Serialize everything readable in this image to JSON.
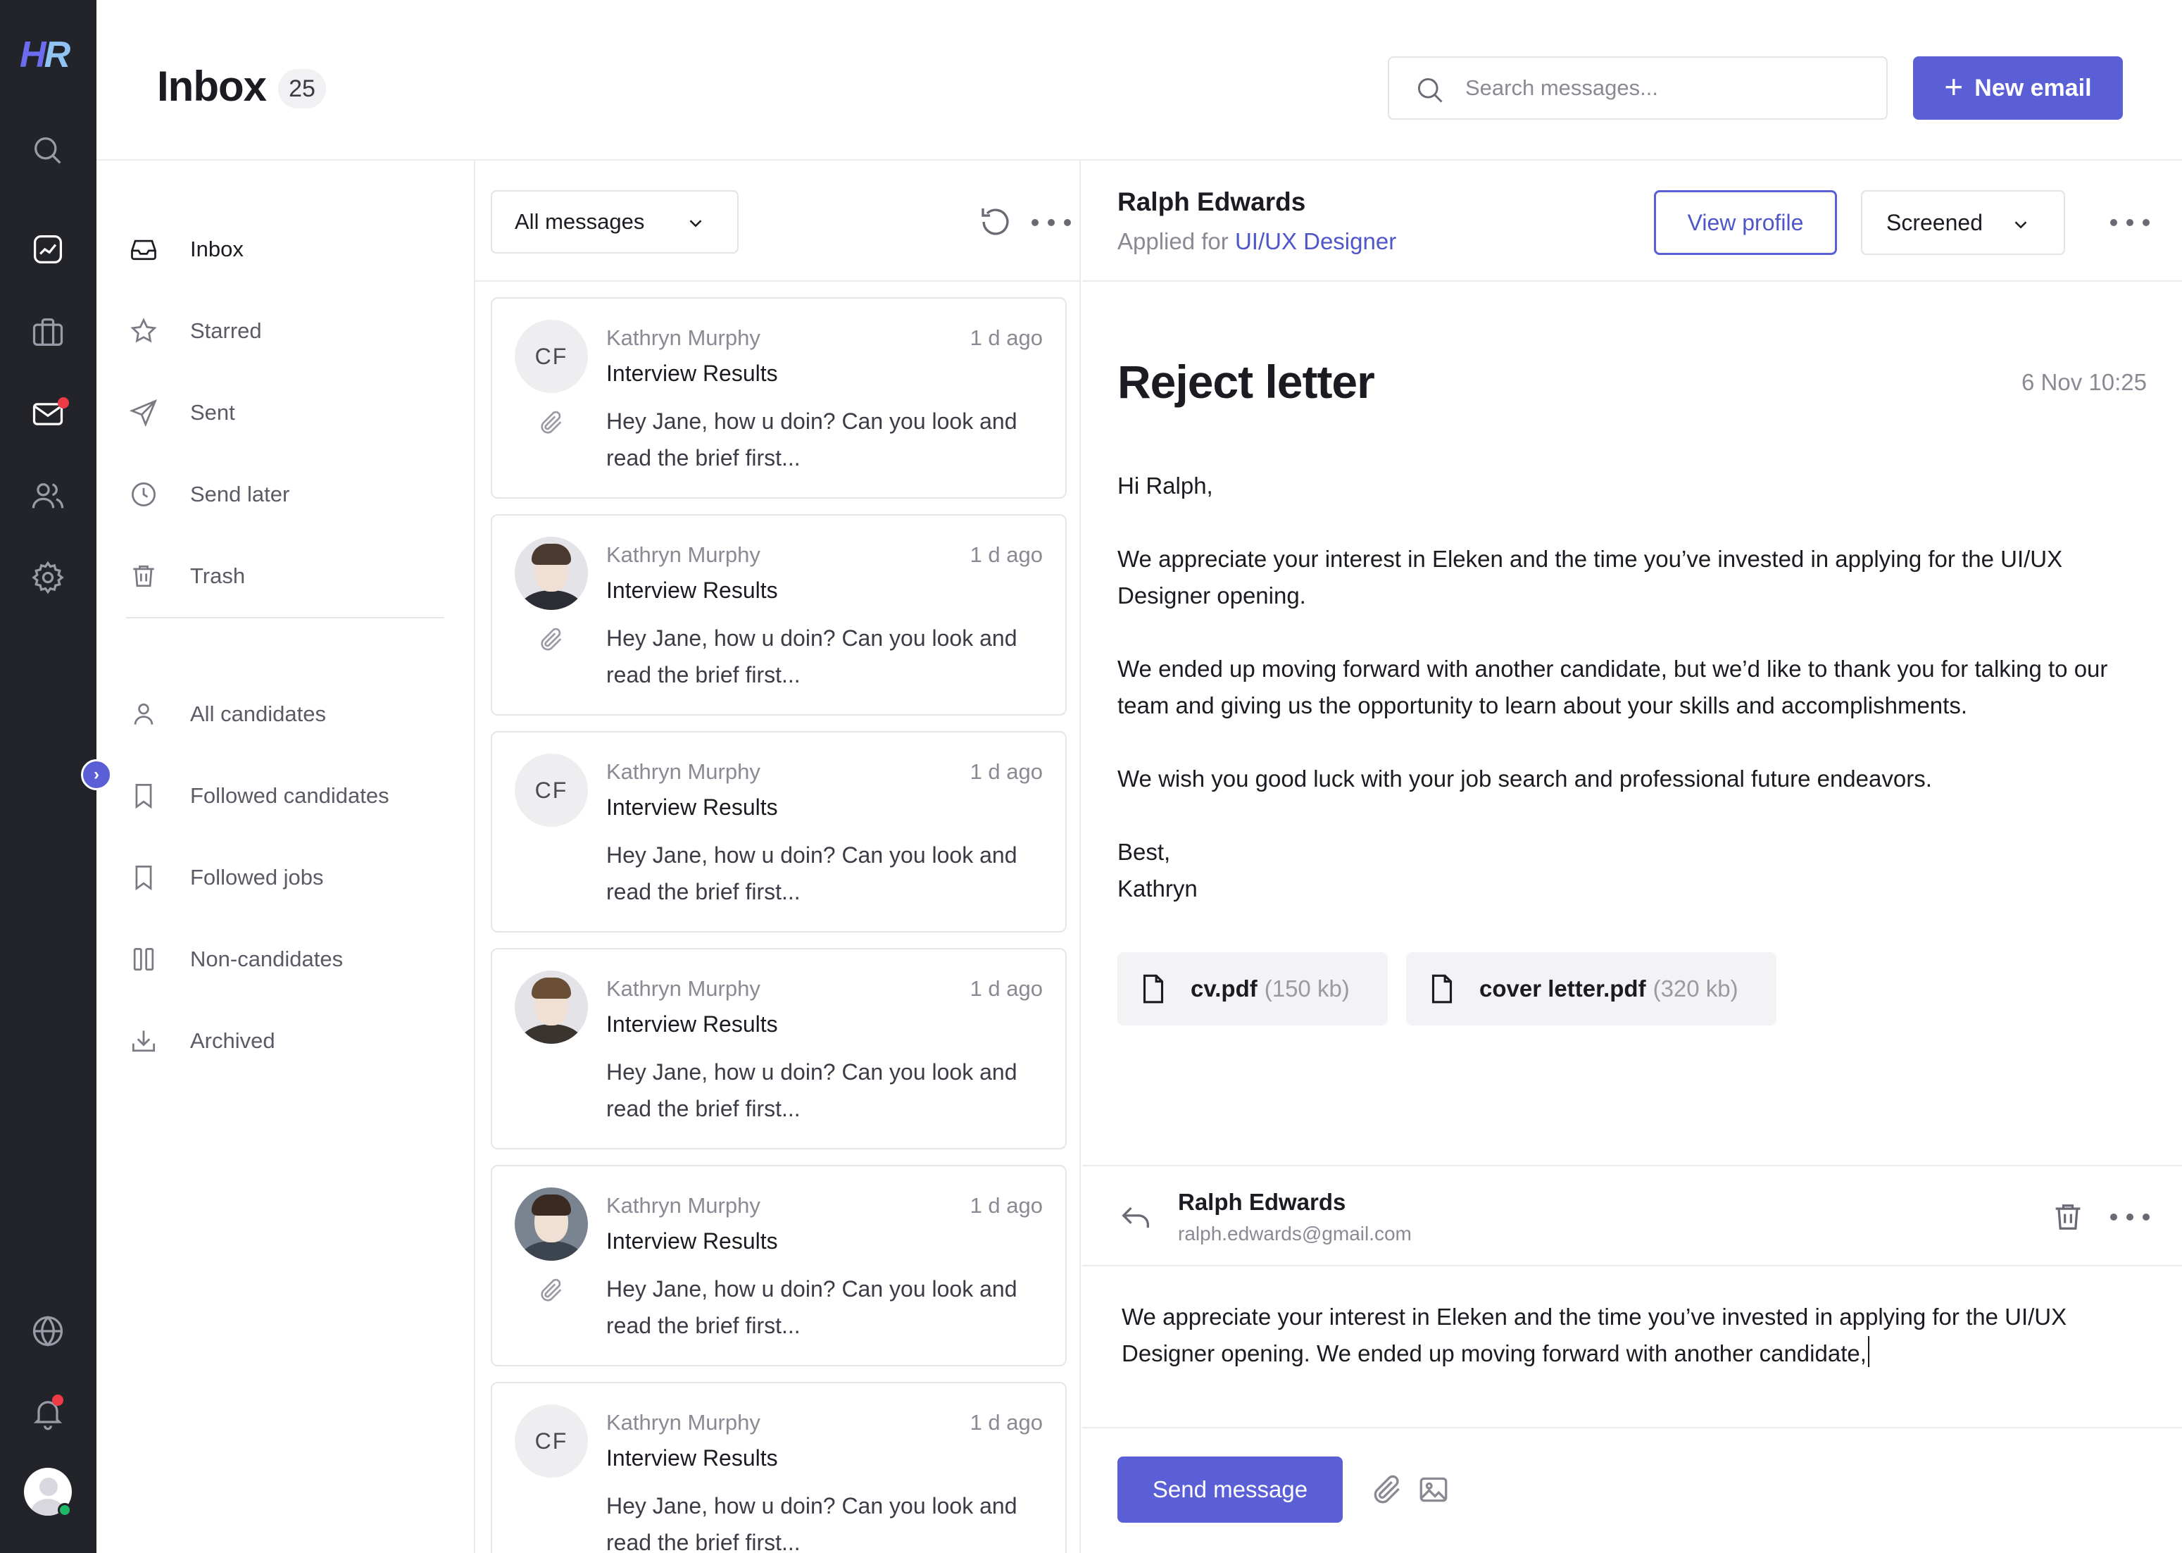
{
  "app": {
    "logo_h": "H",
    "logo_r": "R"
  },
  "header": {
    "title": "Inbox",
    "count": "25",
    "search_placeholder": "Search messages...",
    "new_email_label": "New email"
  },
  "nav": {
    "items": [
      {
        "label": "Inbox",
        "icon": "inbox-icon",
        "active": true
      },
      {
        "label": "Starred",
        "icon": "star-icon"
      },
      {
        "label": "Sent",
        "icon": "send-icon"
      },
      {
        "label": "Send later",
        "icon": "clock-icon"
      },
      {
        "label": "Trash",
        "icon": "trash-icon"
      }
    ],
    "groups": [
      {
        "label": "All candidates",
        "icon": "user-icon"
      },
      {
        "label": "Followed candidates",
        "icon": "bookmark-icon"
      },
      {
        "label": "Followed jobs",
        "icon": "bookmark-icon"
      },
      {
        "label": "Non-candidates",
        "icon": "columns-icon"
      },
      {
        "label": "Archived",
        "icon": "download-icon"
      }
    ]
  },
  "list": {
    "filter_label": "All messages",
    "messages": [
      {
        "initials": "CF",
        "sender": "Kathryn Murphy",
        "time": "1 d ago",
        "subject": "Interview Results",
        "snippet": "Hey Jane, how u doin? Can you look and read the brief first...",
        "attachment": true
      },
      {
        "initials": "",
        "sender": "Kathryn Murphy",
        "time": "1 d ago",
        "subject": "Interview Results",
        "snippet": "Hey Jane, how u doin? Can you look and read the brief first...",
        "attachment": true
      },
      {
        "initials": "CF",
        "sender": "Kathryn Murphy",
        "time": "1 d ago",
        "subject": "Interview Results",
        "snippet": "Hey Jane, how u doin? Can you look and read the brief first...",
        "attachment": false
      },
      {
        "initials": "",
        "sender": "Kathryn Murphy",
        "time": "1 d ago",
        "subject": "Interview Results",
        "snippet": "Hey Jane, how u doin? Can you look and read the brief first...",
        "attachment": false
      },
      {
        "initials": "",
        "sender": "Kathryn Murphy",
        "time": "1 d ago",
        "subject": "Interview Results",
        "snippet": "Hey Jane, how u doin? Can you look and read the brief first...",
        "attachment": true
      },
      {
        "initials": "CF",
        "sender": "Kathryn Murphy",
        "time": "1 d ago",
        "subject": "Interview Results",
        "snippet": "Hey Jane, how u doin? Can you look and read the brief first...",
        "attachment": false
      }
    ]
  },
  "pane": {
    "candidate_name": "Ralph Edwards",
    "applied_prefix": "Applied for",
    "applied_role": "UI/UX Designer",
    "view_profile_label": "View profile",
    "status": "Screened",
    "email": {
      "title": "Reject letter",
      "date": "6 Nov 10:25",
      "greeting": "Hi Ralph,",
      "p1": "We appreciate your interest in Eleken and the time you’ve invested in applying for the UI/UX Designer opening.",
      "p2": "We ended up moving forward with another candidate, but we’d like to thank you for talking to our team and giving us the opportunity to learn about your skills and accomplishments.",
      "p3": "We wish you good luck with your job search and professional future endeavors.",
      "closing": "Best,",
      "signature": "Kathryn"
    },
    "attachments": [
      {
        "name": "cv.pdf",
        "size": "(150 kb)"
      },
      {
        "name": "cover letter.pdf",
        "size": "(320 kb)"
      }
    ],
    "reply": {
      "name": "Ralph Edwards",
      "email": "ralph.edwards@gmail.com",
      "draft": "We appreciate your interest in Eleken and the time you’ve invested in applying for the UI/UX Designer opening. We ended up moving forward with another candidate,",
      "send_label": "Send message"
    }
  },
  "colors": {
    "accent": "#5a5fd6",
    "rail": "#23242a",
    "notification": "#ef3b46",
    "online": "#1fb86a"
  }
}
